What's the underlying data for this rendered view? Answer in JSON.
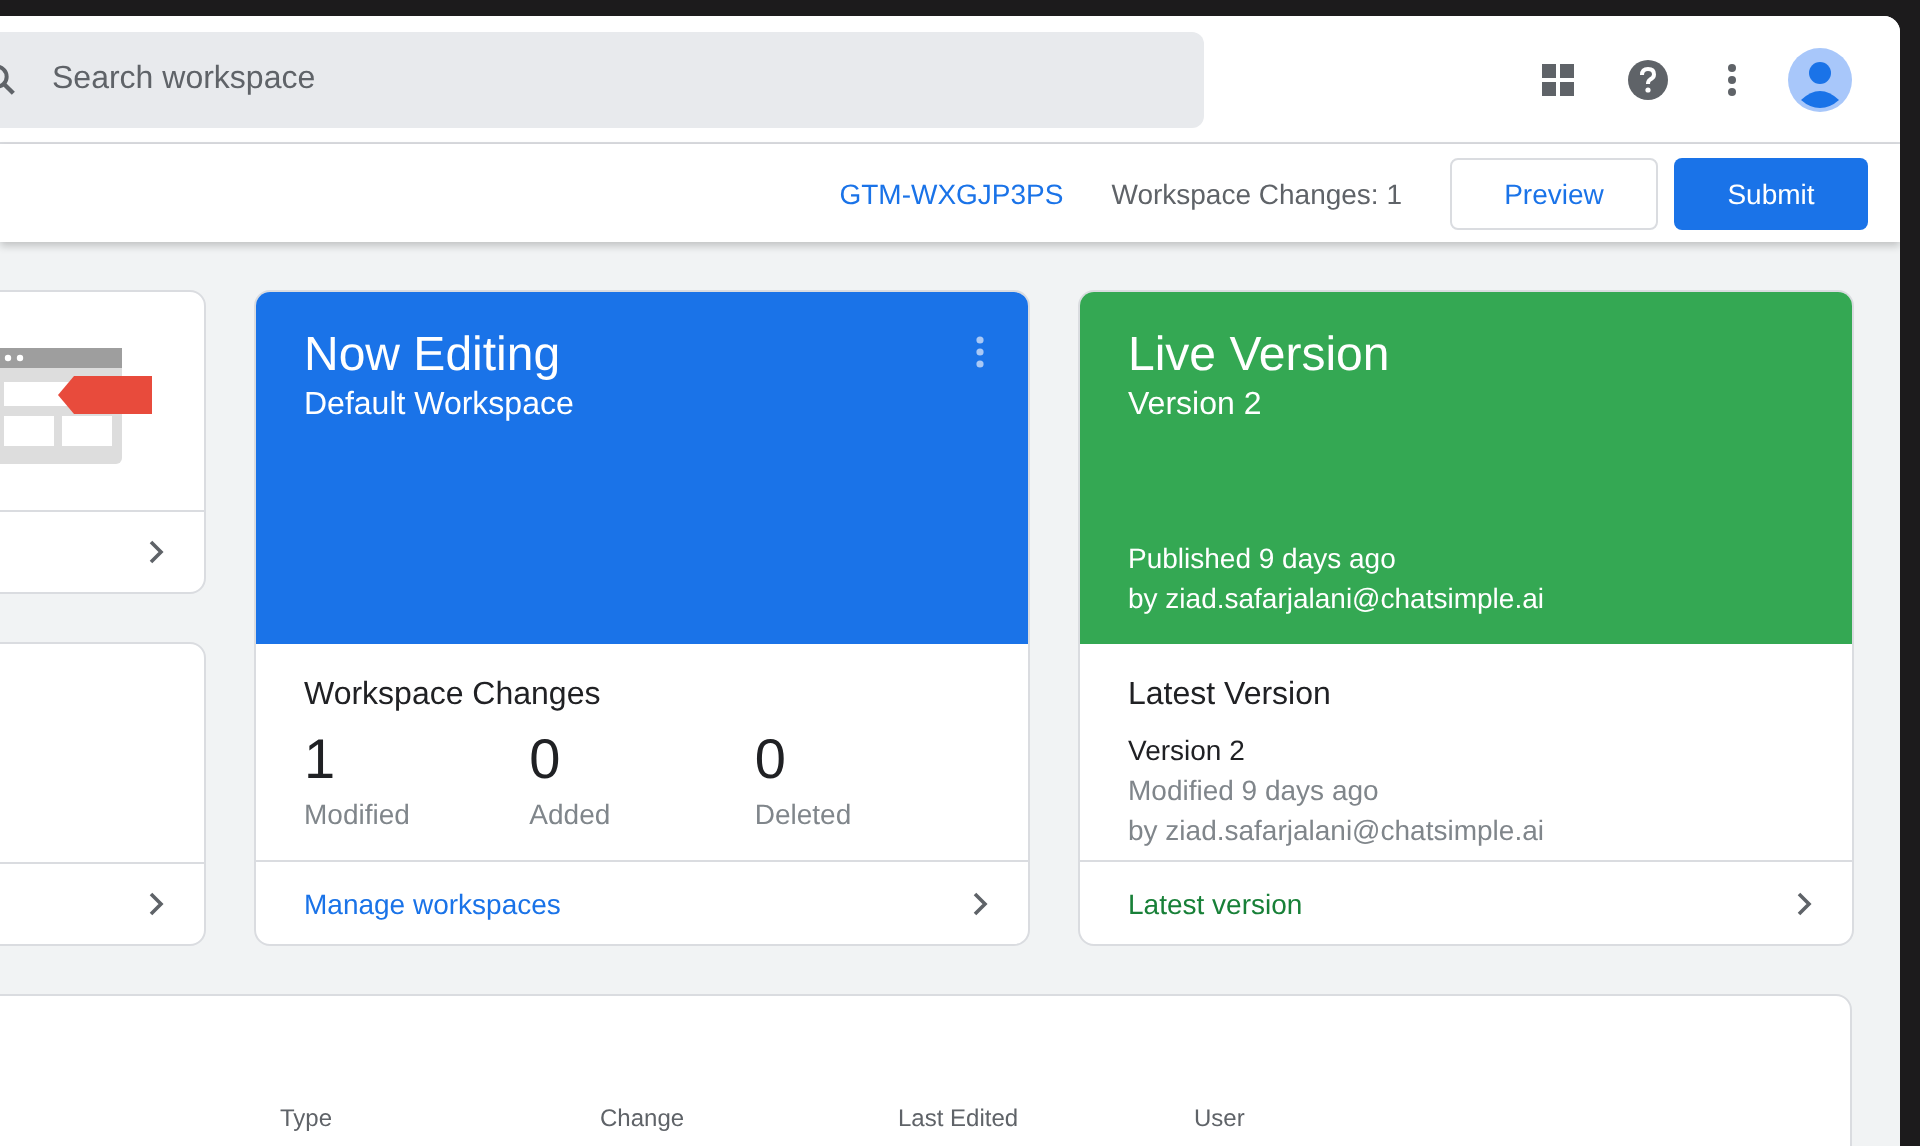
{
  "header": {
    "search": {
      "placeholder": "Search workspace"
    }
  },
  "toolbar": {
    "container_id": "GTM-WXGJP3PS",
    "workspace_changes": "Workspace Changes: 1",
    "buttons": [
      {
        "label": "Preview",
        "kind": "outlined"
      },
      {
        "label": "Submit",
        "kind": "filled"
      }
    ]
  },
  "now_editing": {
    "title": "Now Editing",
    "subtitle": "Default Workspace",
    "changes_title": "Workspace Changes",
    "stats": [
      {
        "value": "1",
        "label": "Modified"
      },
      {
        "value": "0",
        "label": "Added"
      },
      {
        "value": "0",
        "label": "Deleted"
      }
    ],
    "link": "Manage workspaces"
  },
  "live_version": {
    "title": "Live Version",
    "subtitle": "Version 2",
    "published": "Published 9 days ago",
    "published_by": "by ziad.safarjalani@chatsimple.ai",
    "latest_title": "Latest Version",
    "latest_name": "Version 2",
    "modified": "Modified 9 days ago",
    "modified_by": "by ziad.safarjalani@chatsimple.ai",
    "link": "Latest version"
  },
  "changes_table": {
    "columns": [
      "Type",
      "Change",
      "Last Edited",
      "User"
    ]
  }
}
